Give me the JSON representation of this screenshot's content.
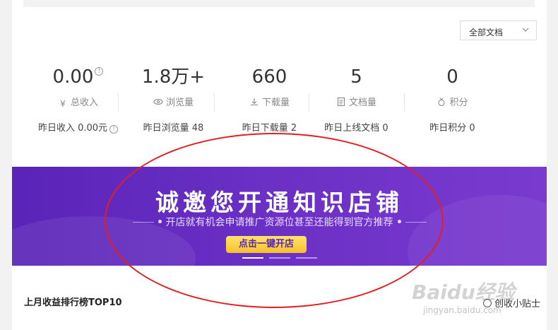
{
  "filter": {
    "selected": "全部文档"
  },
  "stats": [
    {
      "value": "0.00",
      "label": "总收入",
      "icon": "yen-icon",
      "sub": "昨日收入 0.00元",
      "has_info": true
    },
    {
      "value": "1.8万+",
      "label": "浏览量",
      "icon": "eye-icon",
      "sub": "昨日浏览量 48",
      "has_info": false
    },
    {
      "value": "660",
      "label": "下载量",
      "icon": "download-icon",
      "sub": "昨日下载量 2",
      "has_info": false
    },
    {
      "value": "5",
      "label": "文档量",
      "icon": "document-icon",
      "sub": "昨日上线文档 0",
      "has_info": false
    },
    {
      "value": "0",
      "label": "积分",
      "icon": "medal-icon",
      "sub": "昨日积分 0",
      "has_info": false
    }
  ],
  "banner": {
    "title": "诚邀您开通知识店铺",
    "subtitle": "开店就有机会申请推广资源位甚至还能得到官方推荐",
    "cta": "点击一键开店",
    "slides": 3,
    "active_slide": 1
  },
  "ranking": {
    "title": "上月收益排行榜TOP10"
  },
  "tip": {
    "label": "创收小贴士"
  },
  "watermark": {
    "brand": "Baidu经验",
    "url": "jingyan.baidu.com"
  },
  "colors": {
    "banner_start": "#5a24b8",
    "banner_end": "#7a3ad0",
    "cta": "#f6c12a",
    "annotation": "#e02020"
  }
}
